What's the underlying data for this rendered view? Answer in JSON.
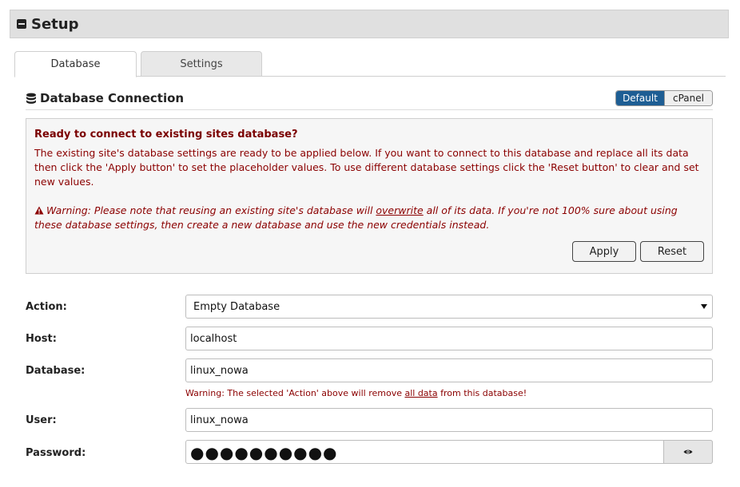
{
  "header": {
    "title": "Setup"
  },
  "tabs": [
    {
      "label": "Database",
      "active": true
    },
    {
      "label": "Settings",
      "active": false
    }
  ],
  "section": {
    "title": "Database Connection",
    "mode_toggle": [
      {
        "label": "Default",
        "active": true
      },
      {
        "label": "cPanel",
        "active": false
      }
    ]
  },
  "notice": {
    "title": "Ready to connect to existing sites database?",
    "text": "The existing site's database settings are ready to be applied below. If you want to connect to this database and replace all its data then click the 'Apply button' to set the placeholder values. To use different database settings click the 'Reset button' to clear and set new values.",
    "warning_before": "Warning: Please note that reusing an existing site's database will ",
    "warning_underlined": "overwrite",
    "warning_after": " all of its data. If you're not 100% sure about using these database settings, then create a new database and use the new credentials instead.",
    "apply_label": "Apply",
    "reset_label": "Reset"
  },
  "form": {
    "action": {
      "label": "Action:",
      "value": "Empty Database"
    },
    "host": {
      "label": "Host:",
      "value": "localhost"
    },
    "database": {
      "label": "Database:",
      "value": "linux_nowa",
      "warning_before": "Warning: The selected 'Action' above will remove ",
      "warning_underlined": "all data",
      "warning_after": " from this database!"
    },
    "user": {
      "label": "User:",
      "value": "linux_nowa"
    },
    "password": {
      "label": "Password:",
      "masked_value": "●●●●●●●●●●"
    }
  },
  "colors": {
    "accent": "#1e5e94",
    "warning_text": "#8b0000",
    "header_bg": "#e0e0e0"
  },
  "icons": {
    "collapse": "minus-square-icon",
    "database": "database-icon",
    "warning": "warning-triangle-icon",
    "dropdown": "caret-down-icon",
    "password_toggle": "eye-icon"
  }
}
